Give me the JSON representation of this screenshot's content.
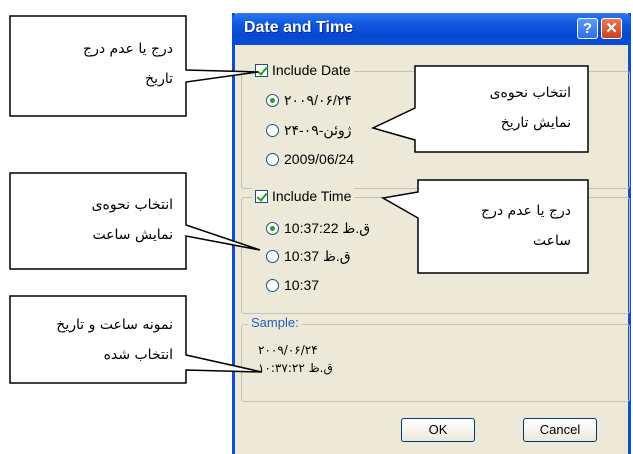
{
  "dialog": {
    "title": "Date and Time",
    "help_label": "?",
    "close_label": "✕",
    "date_group": {
      "checkbox_label": "Include Date",
      "options": [
        "۲۰۰۹/۰۶/۲۴",
        "۲۴-ژوئن-۰۹",
        "2009/06/24"
      ],
      "selected_index": 0
    },
    "time_group": {
      "checkbox_label": "Include Time",
      "options": [
        "10:37:22 ق.ظ",
        "10:37 ق.ظ",
        "10:37"
      ],
      "selected_index": 0
    },
    "sample": {
      "label": "Sample:",
      "line1": "۲۰۰۹/۰۶/۲۴",
      "line2": "۱۰:۳۷:۲۲ ق.ظ"
    },
    "ok_label": "OK",
    "cancel_label": "Cancel"
  },
  "callouts": {
    "include_date": {
      "line1": "درج یا عدم درج",
      "line2": "تاریخ"
    },
    "date_format": {
      "line1": "انتخاب نحوه‌ی",
      "line2": "نمایش تاریخ"
    },
    "time_format": {
      "line1": "انتخاب نحوه‌ی",
      "line2": "نمایش  ساعت"
    },
    "include_time": {
      "line1": "درج یا عدم درج",
      "line2": "ساعت"
    },
    "sample": {
      "line1": "نمونه ساعت و تاریخ",
      "line2": "انتخاب شده"
    }
  },
  "colors": {
    "titlebar": "#0a4fd6",
    "dialog_bg": "#ece9d8",
    "check_green": "#21a121"
  }
}
